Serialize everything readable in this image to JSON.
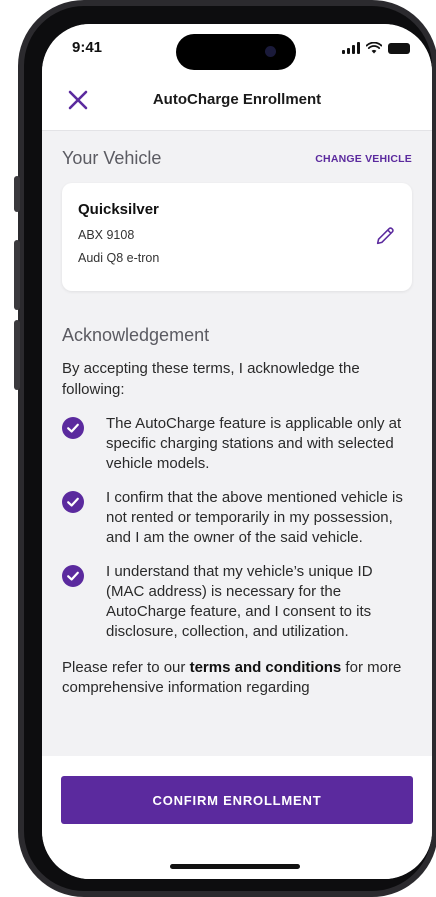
{
  "status_bar": {
    "time": "9:41"
  },
  "header": {
    "title": "AutoCharge Enrollment",
    "close_icon": "close-icon"
  },
  "vehicle_section": {
    "title": "Your Vehicle",
    "change_label": "CHANGE VEHICLE",
    "vehicle": {
      "name": "Quicksilver",
      "plate": "ABX 9108",
      "model": "Audi Q8 e-tron"
    },
    "edit_icon": "pencil-icon"
  },
  "acknowledgement": {
    "title": "Acknowledgement",
    "intro": "By accepting these terms, I acknowledge the following:",
    "items": [
      {
        "text": "The AutoCharge feature is applicable only at specific charging stations and with selected vehicle models."
      },
      {
        "text": "I confirm that the above mentioned vehicle is not rented or temporarily in my possession, and I am the owner of the said vehicle."
      },
      {
        "text": "I understand that my vehicle’s unique ID (MAC address) is necessary for the AutoCharge feature, and I consent to its disclosure, collection, and utilization."
      }
    ],
    "footer_prefix": "Please refer to our ",
    "footer_link": "terms and conditions",
    "footer_suffix": " for more comprehensive information regarding"
  },
  "actions": {
    "confirm_label": "CONFIRM ENROLLMENT"
  },
  "colors": {
    "accent": "#5b2a9e",
    "background": "#f2f2f4",
    "card": "#ffffff"
  }
}
